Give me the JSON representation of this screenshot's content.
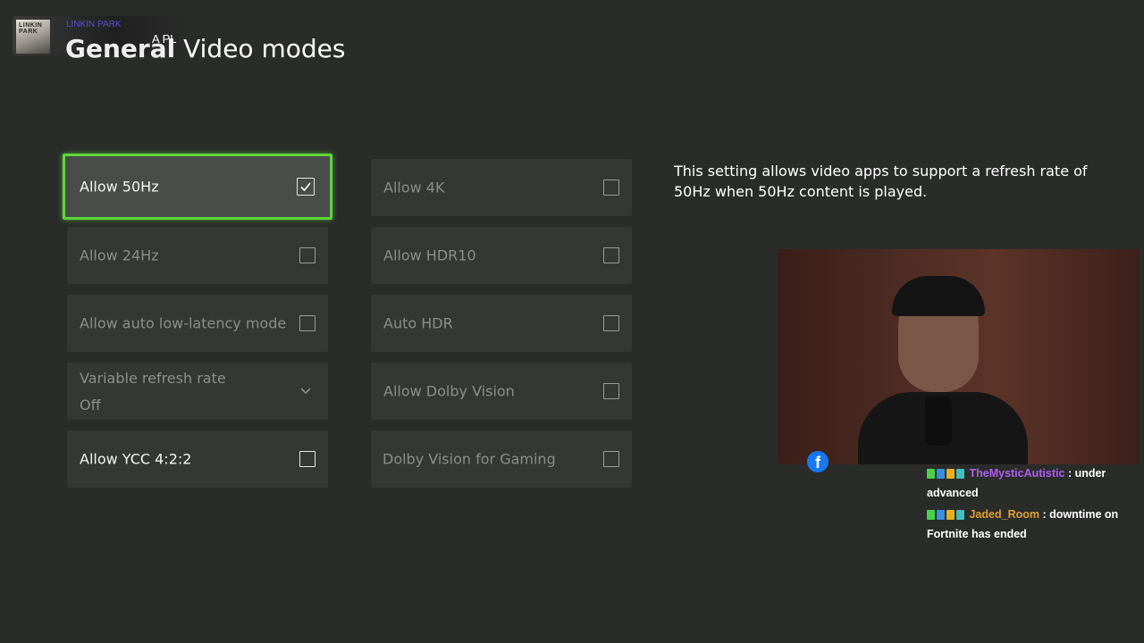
{
  "now_playing": {
    "album_art_text": "LINKIN PARK",
    "artist": "LINKIN PARK",
    "track": "A PL"
  },
  "header": {
    "section": "General",
    "title": "Video modes"
  },
  "settings": {
    "col1": [
      {
        "label": "Allow 50Hz",
        "checked": true,
        "enabled": true,
        "focused": true
      },
      {
        "label": "Allow 24Hz",
        "checked": false,
        "enabled": false
      },
      {
        "label": "Allow auto low-latency mode",
        "checked": false,
        "enabled": false
      },
      {
        "label": "Variable refresh rate",
        "value": "Off",
        "enabled": false,
        "type": "dropdown"
      },
      {
        "label": "Allow YCC 4:2:2",
        "checked": false,
        "enabled": true
      }
    ],
    "col2": [
      {
        "label": "Allow 4K",
        "checked": false,
        "enabled": false
      },
      {
        "label": "Allow HDR10",
        "checked": false,
        "enabled": false
      },
      {
        "label": "Auto HDR",
        "checked": false,
        "enabled": false
      },
      {
        "label": "Allow Dolby Vision",
        "checked": false,
        "enabled": false
      },
      {
        "label": "Dolby Vision for Gaming",
        "checked": false,
        "enabled": false
      }
    ]
  },
  "description": "This setting allows video apps to support a refresh rate of 50Hz when 50Hz content is played.",
  "chat": [
    {
      "user": "TheMysticAutistic",
      "message": ": under advanced",
      "color": "#b05ef0"
    },
    {
      "user": "Jaded_Room",
      "message": ": downtime on Fortnite has ended",
      "color": "#e0a030"
    }
  ],
  "colors": {
    "focus_border": "#5cd63a",
    "background": "#2a2c2a",
    "tile": "#353735",
    "facebook": "#1877f2"
  },
  "icons": {
    "check": "check-icon",
    "dropdown": "chevron-down-icon",
    "facebook": "facebook-icon"
  }
}
